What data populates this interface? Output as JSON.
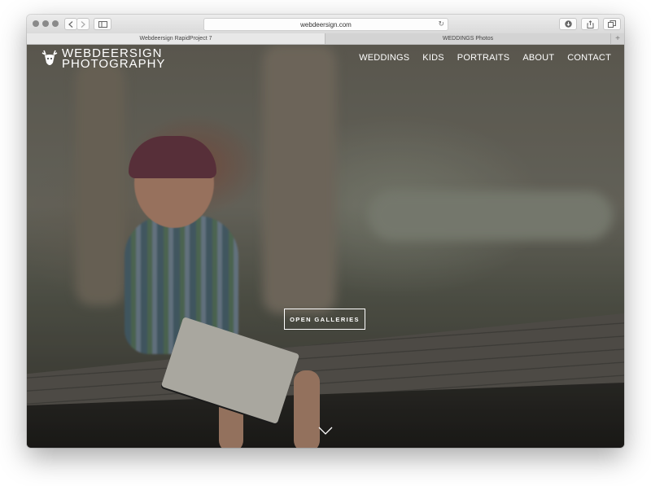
{
  "browser": {
    "url": "webdeersign.com",
    "tabs": [
      {
        "label": "Webdeersign RapidProject 7",
        "active": true
      },
      {
        "label": "WEDDINGS Photos",
        "active": false
      }
    ],
    "new_tab_label": "+"
  },
  "site": {
    "logo_line1": "WEBDEERSIGN",
    "logo_line2": "PHOTOGRAPHY",
    "nav": [
      "WEDDINGS",
      "KIDS",
      "PORTRAITS",
      "ABOUT",
      "CONTACT"
    ],
    "cta_label": "OPEN GALLERIES"
  },
  "icons": {
    "back": "chevron-left-icon",
    "forward": "chevron-right-icon",
    "sidebar": "sidebar-icon",
    "reload": "reload-icon",
    "download": "download-icon",
    "share": "share-icon",
    "tabs": "tabs-icon",
    "logo": "deer-head-icon",
    "scroll": "chevron-down-icon"
  },
  "colors": {
    "nav_text": "#ffffff",
    "browser_chrome": "#e6e6e6"
  }
}
